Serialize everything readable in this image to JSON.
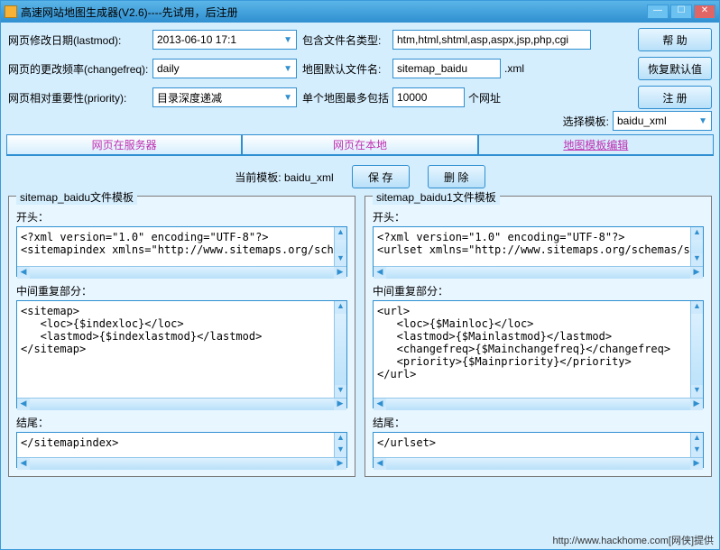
{
  "window": {
    "title": "高速网站地图生成器(V2.6)----先试用，后注册"
  },
  "form": {
    "lastmod_label": "网页修改日期(lastmod):",
    "lastmod_value": "2013-06-10 17:1",
    "changefreq_label": "网页的更改频率(changefreq):",
    "changefreq_value": "daily",
    "priority_label": "网页相对重要性(priority):",
    "priority_value": "目录深度递减",
    "include_label": "包含文件名类型:",
    "include_value": "htm,html,shtml,asp,aspx,jsp,php,cgi",
    "mapname_label": "地图默认文件名:",
    "mapname_value": "sitemap_baidu",
    "mapname_suffix": ".xml",
    "maxurl_label": "单个地图最多包括",
    "maxurl_value": "10000",
    "maxurl_suffix": "个网址",
    "tplsel_label": "选择模板:",
    "tplsel_value": "baidu_xml"
  },
  "buttons": {
    "help": "帮 助",
    "restore": "恢复默认值",
    "register": "注 册",
    "save": "保 存",
    "delete": "删 除"
  },
  "tabs": {
    "server": "网页在服务器",
    "local": "网页在本地",
    "editor": "地图模板编辑"
  },
  "current_tpl_label": "当前模板:",
  "current_tpl_value": "baidu_xml",
  "left": {
    "legend": "sitemap_baidu文件模板",
    "head_label": "开头：",
    "head_value": "<?xml version=\"1.0\" encoding=\"UTF-8\"?>\n<sitemapindex xmlns=\"http://www.sitemaps.org/sche",
    "mid_label": "中间重复部分：",
    "mid_value": "<sitemap>\n   <loc>{$indexloc}</loc>\n   <lastmod>{$indexlastmod}</lastmod>\n</sitemap>",
    "end_label": "结尾：",
    "end_value": "</sitemapindex>"
  },
  "right": {
    "legend": "sitemap_baidu1文件模板",
    "head_label": "开头：",
    "head_value": "<?xml version=\"1.0\" encoding=\"UTF-8\"?>\n<urlset xmlns=\"http://www.sitemaps.org/schemas/site",
    "mid_label": "中间重复部分：",
    "mid_value": "<url>\n   <loc>{$Mainloc}</loc>\n   <lastmod>{$Mainlastmod}</lastmod>\n   <changefreq>{$Mainchangefreq}</changefreq>\n   <priority>{$Mainpriority}</priority>\n</url>",
    "end_label": "结尾：",
    "end_value": "</urlset>"
  },
  "footer": "http://www.hackhome.com[网侠]提供"
}
